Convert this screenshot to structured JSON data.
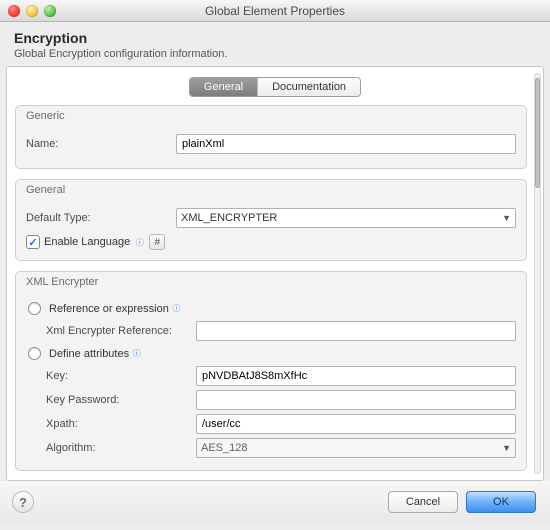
{
  "window": {
    "title": "Global Element Properties"
  },
  "header": {
    "title": "Encryption",
    "subtitle": "Global Encryption configuration information."
  },
  "tabs": {
    "general": "General",
    "documentation": "Documentation"
  },
  "generic": {
    "legend": "Generic",
    "name_label": "Name:",
    "name_value": "plainXml"
  },
  "general": {
    "legend": "General",
    "default_type_label": "Default Type:",
    "default_type_value": "XML_ENCRYPTER",
    "enable_language_label": "Enable Language",
    "enable_language_checked": true
  },
  "xml_encrypter": {
    "legend": "XML Encrypter",
    "reference_label": "Reference or expression",
    "reference_field_label": "Xml Encrypter Reference:",
    "reference_field_value": "",
    "define_attr_label": "Define attributes",
    "key_label": "Key:",
    "key_value": "pNVDBAtJ8S8mXfHc",
    "key_password_label": "Key Password:",
    "key_password_value": "",
    "xpath_label": "Xpath:",
    "xpath_value": "/user/cc",
    "algorithm_label": "Algorithm:",
    "algorithm_value": "AES_128"
  },
  "footer": {
    "cancel": "Cancel",
    "ok": "OK"
  },
  "glyphs": {
    "hash": "#",
    "check": "✓",
    "question": "?",
    "caret": "▼",
    "info": "ⓘ"
  }
}
